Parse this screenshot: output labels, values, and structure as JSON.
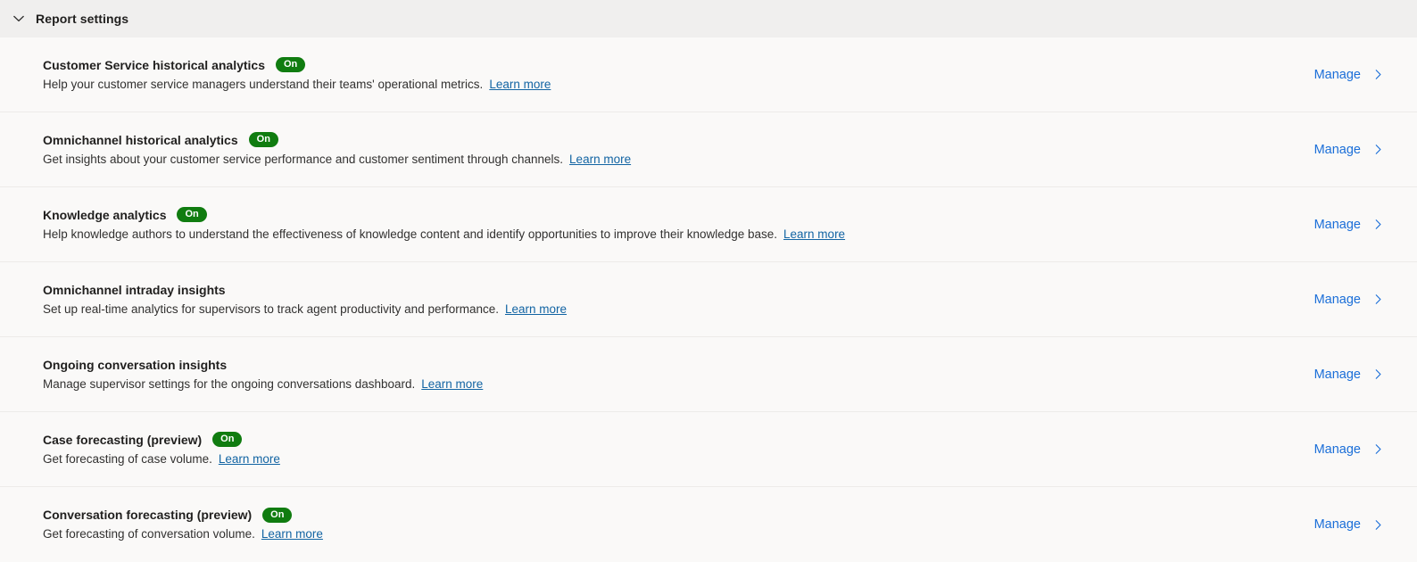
{
  "header": {
    "title": "Report settings",
    "collapse_icon": "chevron-down-icon"
  },
  "labels": {
    "manage": "Manage",
    "learn_more": "Learn more",
    "manage_chevron_icon": "chevron-right-icon"
  },
  "colors": {
    "badge_on": "#107c10",
    "link": "#1a6ed8",
    "learn_more_link": "#1264a3",
    "header_background": "#f0efee",
    "body_background": "#faf9f8",
    "row_divider": "#edebe9",
    "title_text": "#201f1e"
  },
  "rows": [
    {
      "title": "Customer Service historical analytics",
      "status": "On",
      "description": "Help your customer service managers understand their teams' operational metrics.",
      "learn_more": "Learn more",
      "manage": "Manage"
    },
    {
      "title": "Omnichannel historical analytics",
      "status": "On",
      "description": "Get insights about your customer service performance and customer sentiment through channels.",
      "learn_more": "Learn more",
      "manage": "Manage"
    },
    {
      "title": "Knowledge analytics",
      "status": "On",
      "description": "Help knowledge authors to understand the effectiveness of knowledge content and identify opportunities to improve their knowledge base.",
      "learn_more": "Learn more",
      "manage": "Manage"
    },
    {
      "title": "Omnichannel intraday insights",
      "status": "",
      "description": "Set up real-time analytics for supervisors to track agent productivity and performance.",
      "learn_more": "Learn more",
      "manage": "Manage"
    },
    {
      "title": "Ongoing conversation insights",
      "status": "",
      "description": "Manage supervisor settings for the ongoing conversations dashboard.",
      "learn_more": "Learn more",
      "manage": "Manage"
    },
    {
      "title": "Case forecasting (preview)",
      "status": "On",
      "description": "Get forecasting of case volume.",
      "learn_more": "Learn more",
      "manage": "Manage"
    },
    {
      "title": "Conversation forecasting (preview)",
      "status": "On",
      "description": "Get forecasting of conversation volume.",
      "learn_more": "Learn more",
      "manage": "Manage"
    }
  ]
}
